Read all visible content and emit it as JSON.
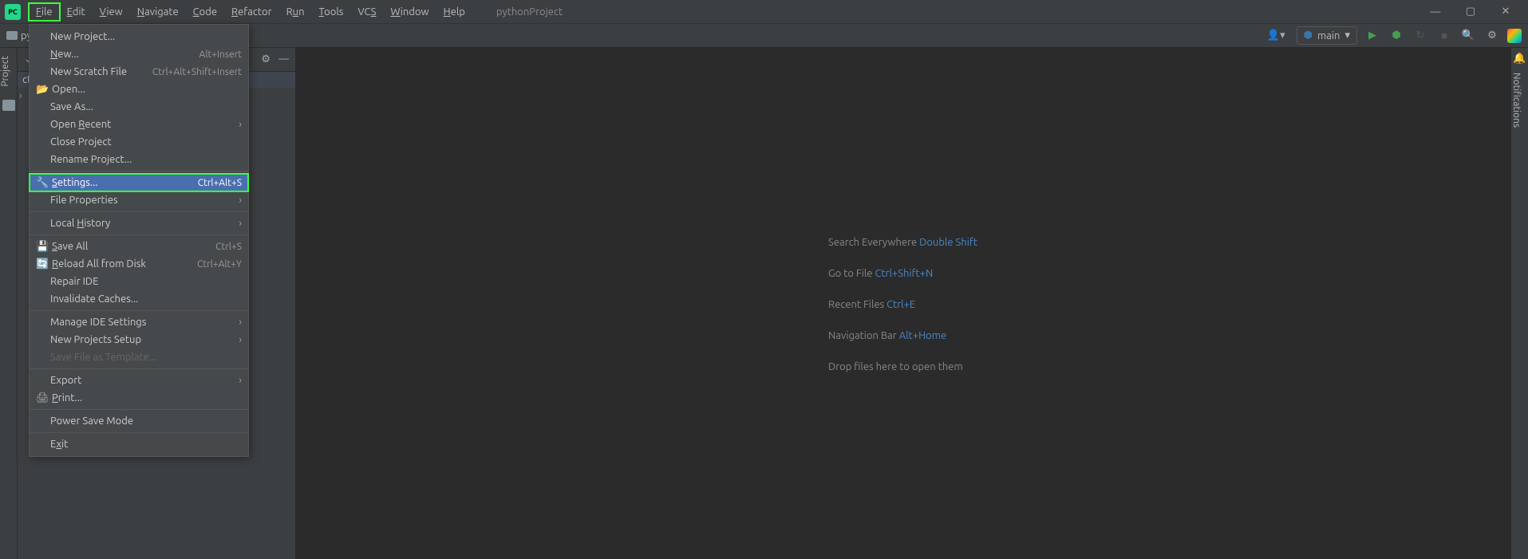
{
  "menubar": {
    "items": [
      "File",
      "Edit",
      "View",
      "Navigate",
      "Code",
      "Refactor",
      "Run",
      "Tools",
      "VCS",
      "Window",
      "Help"
    ],
    "underlines": [
      "F",
      "E",
      "V",
      "N",
      "C",
      "R",
      "u",
      "T",
      "S",
      "W",
      "H"
    ],
    "project": "pythonProject"
  },
  "toolbar": {
    "breadcrumb": "py",
    "run_config": "main",
    "path_tail": "cts\\pythonP"
  },
  "left_rail": {
    "label": "Project"
  },
  "right_rail": {
    "label": "Notifications"
  },
  "dropdown": {
    "items": [
      {
        "label": "New Project...",
        "type": "item"
      },
      {
        "label": "New...",
        "shortcut": "Alt+Insert",
        "type": "item"
      },
      {
        "label": "New Scratch File",
        "shortcut": "Ctrl+Alt+Shift+Insert",
        "type": "item"
      },
      {
        "label": "Open...",
        "icon": "folder-open",
        "type": "item"
      },
      {
        "label": "Save As...",
        "type": "item"
      },
      {
        "label": "Open Recent",
        "submenu": true,
        "type": "item"
      },
      {
        "label": "Close Project",
        "type": "item"
      },
      {
        "label": "Rename Project...",
        "type": "item"
      },
      {
        "type": "sep"
      },
      {
        "label": "Settings...",
        "shortcut": "Ctrl+Alt+S",
        "icon": "wrench",
        "highlighted": true,
        "type": "item"
      },
      {
        "label": "File Properties",
        "submenu": true,
        "type": "item"
      },
      {
        "type": "sep"
      },
      {
        "label": "Local History",
        "submenu": true,
        "type": "item"
      },
      {
        "type": "sep"
      },
      {
        "label": "Save All",
        "shortcut": "Ctrl+S",
        "icon": "save",
        "type": "item"
      },
      {
        "label": "Reload All from Disk",
        "shortcut": "Ctrl+Alt+Y",
        "icon": "reload",
        "type": "item"
      },
      {
        "label": "Repair IDE",
        "type": "item"
      },
      {
        "label": "Invalidate Caches...",
        "type": "item"
      },
      {
        "type": "sep"
      },
      {
        "label": "Manage IDE Settings",
        "submenu": true,
        "type": "item"
      },
      {
        "label": "New Projects Setup",
        "submenu": true,
        "type": "item"
      },
      {
        "label": "Save File as Template...",
        "disabled": true,
        "type": "item"
      },
      {
        "type": "sep"
      },
      {
        "label": "Export",
        "submenu": true,
        "type": "item"
      },
      {
        "label": "Print...",
        "icon": "print",
        "type": "item"
      },
      {
        "type": "sep"
      },
      {
        "label": "Power Save Mode",
        "type": "item"
      },
      {
        "type": "sep"
      },
      {
        "label": "Exit",
        "type": "item"
      }
    ]
  },
  "hints": [
    {
      "text": "Search Everywhere",
      "kb": "Double Shift"
    },
    {
      "text": "Go to File",
      "kb": "Ctrl+Shift+N"
    },
    {
      "text": "Recent Files",
      "kb": "Ctrl+E"
    },
    {
      "text": "Navigation Bar",
      "kb": "Alt+Home"
    },
    {
      "text": "Drop files here to open them",
      "kb": ""
    }
  ]
}
